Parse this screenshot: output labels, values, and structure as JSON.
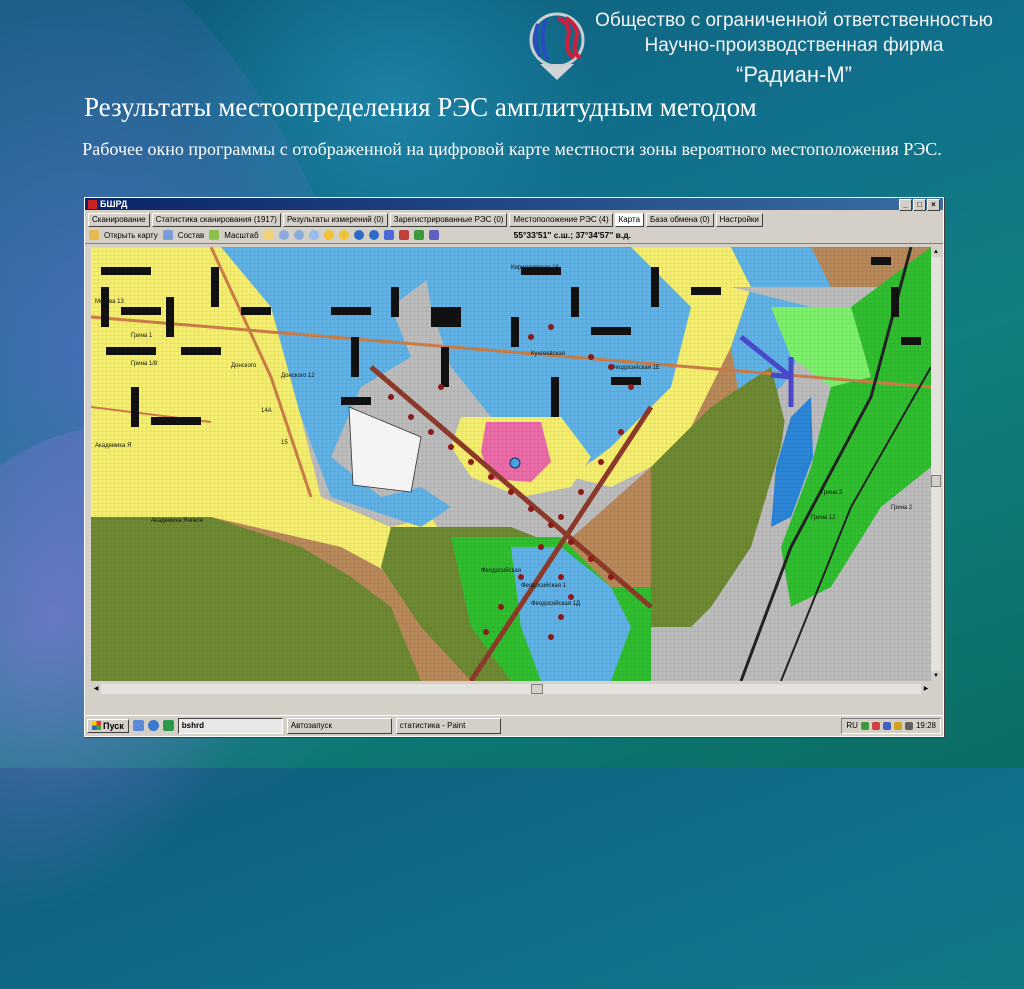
{
  "company": {
    "line1": "Общество с ограниченной ответственностью",
    "line2": "Научно-производственная фирма",
    "line3": "“Радиан-М”"
  },
  "slide": {
    "title": "Результаты местоопределения РЭС амплитудным методом",
    "subtitle": "Рабочее окно программы с отображенной на цифровой карте местности зоны вероятного местоположения РЭС."
  },
  "window": {
    "title": "БШРД",
    "buttons": [
      "_",
      "□",
      "×"
    ]
  },
  "tabs": [
    "Сканирование",
    "Статистика сканирования (1917)",
    "Результаты измерений (0)",
    "Зарегистрированные РЭС (0)",
    "Местоположение РЭС (4)",
    "Карта",
    "База обмена (0)",
    "Настройки"
  ],
  "active_tab": "Карта",
  "toolbar": {
    "open_map": "Открыть карту",
    "layers": "Состав",
    "scale": "Масштаб",
    "coordinates": "55°33'51'' с.ш.; 37°34'57'' в.д."
  },
  "map": {
    "labels": [
      "Москва 13",
      "Грина 1",
      "Грина 1/8",
      "Донского 12",
      "Донского",
      "14А",
      "15",
      "Академика Я",
      "Академика Янгеля",
      "Феодосийская",
      "Феодосийская 1",
      "Феодосийская 1Д",
      "Кунгеевская",
      "Грина 3",
      "Грина 2",
      "Кирилловская 18",
      "Феодосийская 1Е",
      "Грина 12"
    ],
    "colors": {
      "blue": "#5fb3e6",
      "yellow": "#f6f06e",
      "pink": "#ec6ba8",
      "green": "#2fbf2f",
      "lightgreen": "#7cf26b",
      "brown": "#b9895a",
      "olive": "#6e8a33",
      "gray": "#bdbdbd"
    }
  },
  "taskbar": {
    "start": "Пуск",
    "tasks": [
      "bshrd",
      "Автозапуск",
      "статистика - Paint"
    ],
    "lang": "RU",
    "time": "19:28"
  }
}
